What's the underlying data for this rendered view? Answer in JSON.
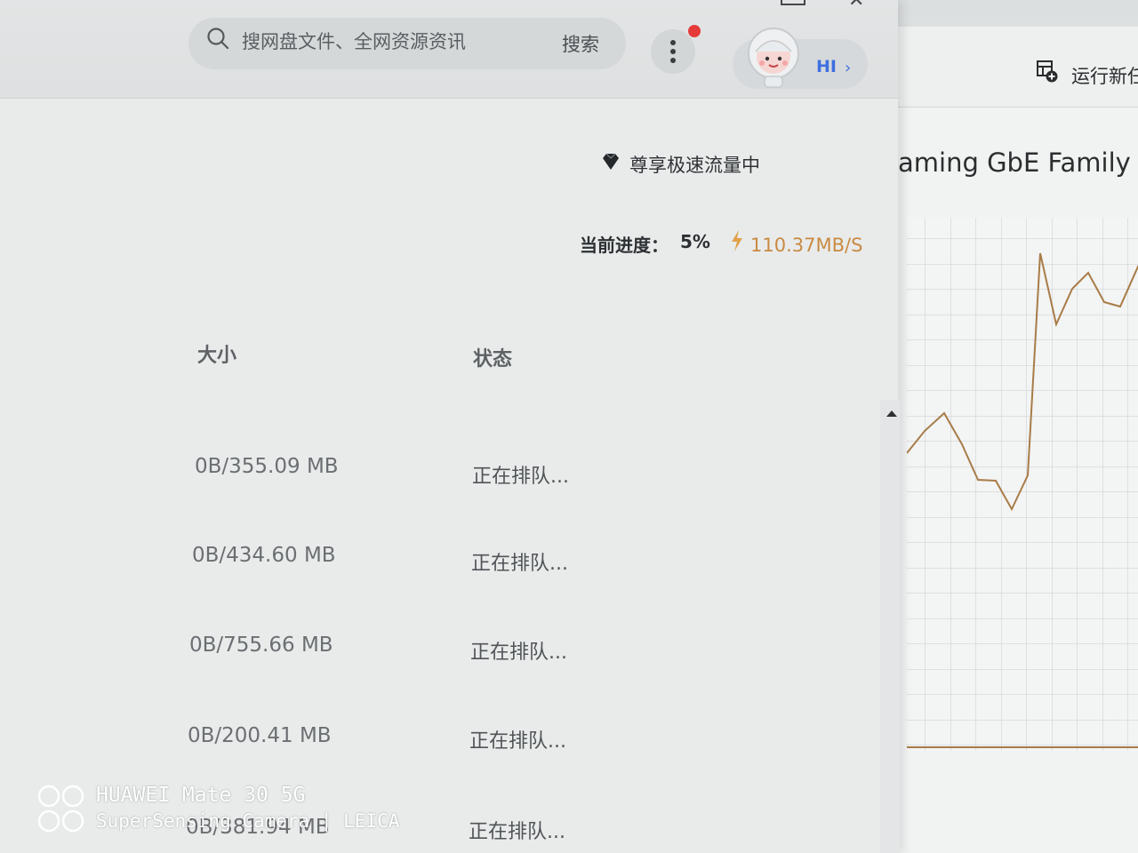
{
  "task_manager": {
    "run_new_task_label": "运行新任",
    "adapter_name": "aming GbE Family Co",
    "graph_line_color": "#a87c48"
  },
  "header": {
    "search_placeholder": "搜网盘文件、全网资源资讯",
    "search_button": "搜索",
    "user_greeting": "HI",
    "user_chevron": "›",
    "notification_color": "#e53a3a"
  },
  "status": {
    "vip_text": "尊享极速流量中",
    "progress_label": "当前进度：",
    "progress_value": "5%",
    "speed": "110.37MB/S",
    "speed_color": "#c98a42"
  },
  "table": {
    "columns": {
      "size": "大小",
      "status": "状态"
    },
    "rows": [
      {
        "size": "0B/355.09 MB",
        "status": "正在排队..."
      },
      {
        "size": "0B/434.60 MB",
        "status": "正在排队..."
      },
      {
        "size": "0B/755.66 MB",
        "status": "正在排队..."
      },
      {
        "size": "0B/200.41 MB",
        "status": "正在排队..."
      },
      {
        "size": "0B/381.94 MB",
        "status": "正在排队..."
      }
    ]
  },
  "watermark": {
    "line1": "HUAWEI Mate 30 5G",
    "line2": "SuperSensing Camera | LEICA"
  }
}
